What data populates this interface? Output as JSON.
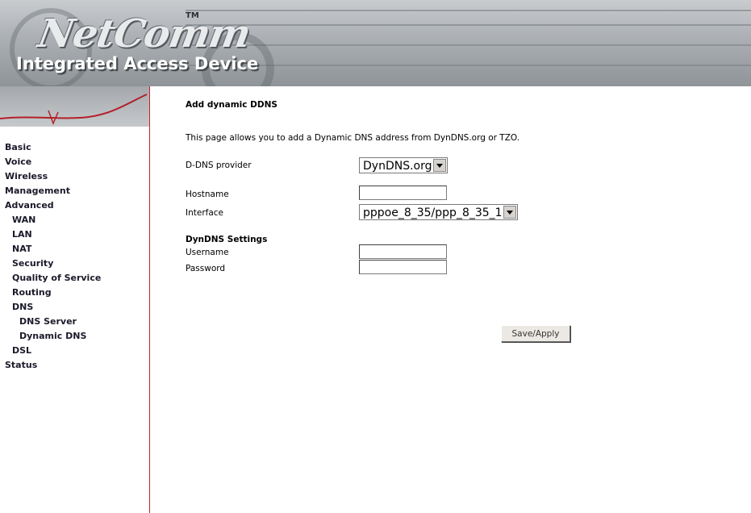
{
  "header": {
    "logo": "NetComm",
    "trademark": "TM",
    "subtitle": "Integrated Access Device"
  },
  "sidebar": {
    "items": [
      {
        "label": "Basic",
        "level": 1
      },
      {
        "label": "Voice",
        "level": 1
      },
      {
        "label": "Wireless",
        "level": 1
      },
      {
        "label": "Management",
        "level": 1
      },
      {
        "label": "Advanced",
        "level": 1
      },
      {
        "label": "WAN",
        "level": 2
      },
      {
        "label": "LAN",
        "level": 2
      },
      {
        "label": "NAT",
        "level": 2
      },
      {
        "label": "Security",
        "level": 2
      },
      {
        "label": "Quality of Service",
        "level": 2
      },
      {
        "label": "Routing",
        "level": 2
      },
      {
        "label": "DNS",
        "level": 2
      },
      {
        "label": "DNS Server",
        "level": 3
      },
      {
        "label": "Dynamic DNS",
        "level": 3
      },
      {
        "label": "DSL",
        "level": 2
      },
      {
        "label": "Status",
        "level": 1
      }
    ]
  },
  "main": {
    "title": "Add dynamic DDNS",
    "description": "This page allows you to add a Dynamic DNS address from DynDNS.org or TZO.",
    "provider_label": "D-DNS provider",
    "provider_value": "DynDNS.org",
    "hostname_label": "Hostname",
    "hostname_value": "",
    "interface_label": "Interface",
    "interface_value": "pppoe_8_35/ppp_8_35_1",
    "settings_heading": "DynDNS Settings",
    "username_label": "Username",
    "username_value": "",
    "password_label": "Password",
    "password_value": "",
    "save_label": "Save/Apply"
  },
  "colors": {
    "sidebar_divider": "#c8202a",
    "banner": "#aeb2b6"
  }
}
